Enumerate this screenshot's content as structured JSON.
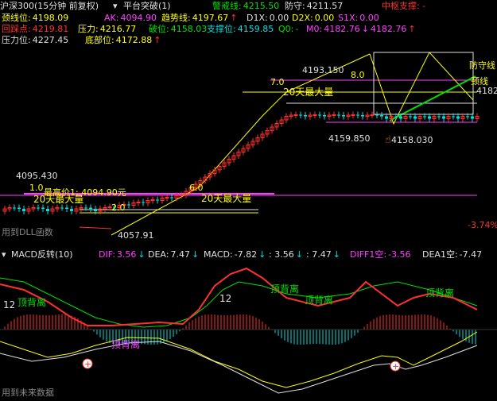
{
  "header": {
    "symbol": "沪深300(15分钟 前复权)",
    "indicator": "平台突破(1)",
    "warn_label": "警戒线:",
    "warn_value": "4215.50",
    "defend_label": "防守:",
    "defend_value": "4211.57",
    "center_label": "中枢支撑: -",
    "neck_label": "颈线位:",
    "neck_value": "4198.09",
    "ak_label": "AK:",
    "ak_value": "4094.90",
    "trend_label": "趋势线:",
    "trend_value": "4197.67",
    "d1x_label": "D1X:",
    "d1x_value": "0.00",
    "d2x_label": "D2X:",
    "d2x_value": "0.00",
    "s1x_label": "S1X:",
    "s1x_value": "0.00",
    "pullback_label": "回踩点:",
    "pullback_value": "4219.81",
    "pressure1_label": "压力:",
    "pressure1_value": "4216.77",
    "break_label": "破位:",
    "break_value": "4158.03",
    "support_label": "支撑位:",
    "support_value": "4159.85",
    "q0_label": "Q0:",
    "q0_value": "-",
    "m0_label": "M0:",
    "m0_value1": "4182.76",
    "m0_value2": "4182.76",
    "pressure2_label": "压力位:",
    "pressure2_value": "4227.45",
    "bottom_label": "底部位:",
    "bottom_value": "4172.88"
  },
  "chart": {
    "labels": {
      "high_4193": "4193.150",
      "low_4159": "4159.850",
      "low_4158": "4158.030",
      "high_4095": "4095.430",
      "low_4057": "4057.91",
      "pct": "-3.74%",
      "v70": "7.0",
      "v60": "6.0",
      "v80": "8.0",
      "v10": "1.0",
      "v20": "2.0",
      "vol20a": "20天最大量",
      "vol20b": "20天最大量",
      "vol20c": "20天最大量",
      "max_price": "最高价1: 4094.90元",
      "neck_side": "颈线",
      "right_value": "4182",
      "pressure_side": "防守线",
      "dll_note": "用到DLL函数"
    }
  },
  "macd": {
    "title": "MACD反转(10)",
    "dif_label": "DIF:",
    "dif_value": "3.56",
    "dea_label": "DEA:",
    "dea_value": "7.47",
    "macd_label": "MACD:",
    "macd_value": "-7.82",
    "v1": ": 3.56",
    "v2": ": 7.47",
    "diff1_label": "DIFF1空:",
    "diff1_value": "-3.56",
    "dea1_label": "DEA1空:",
    "dea1_value": "-7.47",
    "annotations": {
      "bei1": "顶背离",
      "bei2": "顶背离",
      "bei3": "顶背离",
      "bei4": "顶背离",
      "bei5": "顶背离",
      "n12a": "12",
      "n12b": "12",
      "future_note": "用到未来数据"
    }
  },
  "colors": {
    "up": "#ff3030",
    "down": "#00e0e0",
    "yellow": "#ffff00",
    "magenta": "#ff40ff",
    "green": "#00e000"
  }
}
